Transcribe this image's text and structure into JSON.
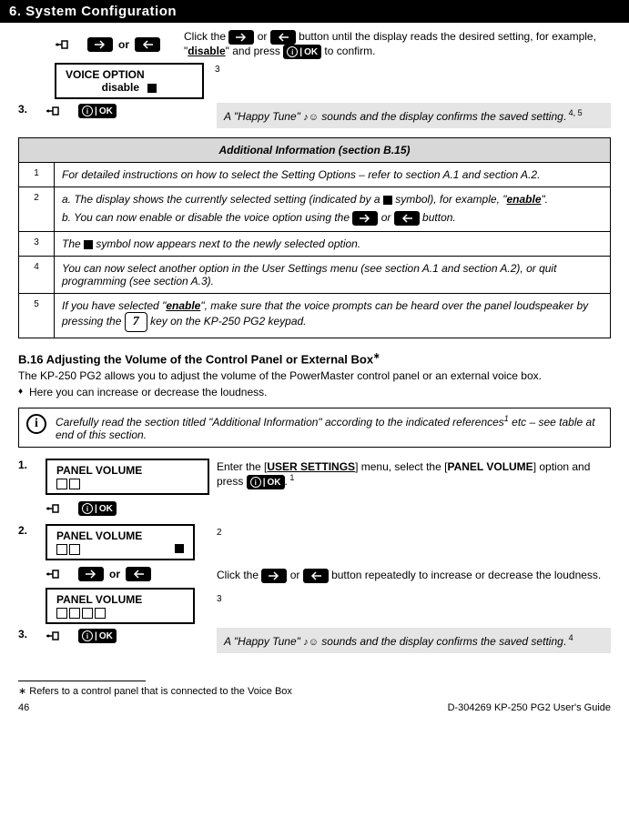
{
  "chapterTitle": "6. System Configuration",
  "voice": {
    "intro_pre": "Click the ",
    "intro_mid": " or ",
    "intro_post": " button until the display reads the desired setting, for example, \"",
    "bold_disable": "disable",
    "intro_after_bold": "\" and press ",
    "intro_end": " to confirm.",
    "lcd_line1": "VOICE OPTION",
    "lcd_line2_label": "disable",
    "ref3_marker": "3"
  },
  "step3": {
    "num": "3.",
    "msg_pre": "A \"Happy Tune\" ",
    "msg_post": " sounds and the display confirms the saved setting",
    "msg_period": ".",
    "msg_refs": " 4, 5"
  },
  "infoTable": {
    "heading": "Additional Information (section B.15)",
    "r1_num": "1",
    "r1": "For detailed instructions on how to select the Setting Options – refer to section A.1 and section A.2.",
    "r2_num": "2",
    "r2a_pre": "a.   The display shows the currently selected setting (indicated by a ",
    "r2a_post": " symbol), for example, \"",
    "r2a_bold": "enable",
    "r2a_end": "\".",
    "r2b_pre": "b.   You can now enable or disable the voice option using the ",
    "r2b_mid": " or ",
    "r2b_post": " button.",
    "r3_num": "3",
    "r3_pre": "The ",
    "r3_post": " symbol now appears next to the newly selected option.",
    "r4_num": "4",
    "r4": "You can now select another option in the User Settings menu (see section A.1 and section A.2), or quit programming (see section A.3).",
    "r5_num": "5",
    "r5_pre": "If you have selected \"",
    "r5_bold": "enable",
    "r5_mid": "\", make sure that the voice prompts can be heard over the panel loudspeaker by pressing the ",
    "r5_key": "7",
    "r5_post": " key on the KP-250 PG2 keypad."
  },
  "b16": {
    "heading": "B.16 Adjusting the Volume of the Control Panel or External Box",
    "heading_star": "∗",
    "p1": "The KP-250 PG2 allows you to adjust the volume of the PowerMaster control panel or an external voice box.",
    "p2": "Here you can increase or decrease the loudness.",
    "note": "Carefully read the section titled \"Additional Information\" according to the indicated references",
    "note_sup": "1",
    "note_post": " etc – see table at end of this section."
  },
  "vol": {
    "step1_num": "1.",
    "step1_lcd": "PANEL VOLUME",
    "step1_right_pre": "Enter the [",
    "step1_menu": "USER SETTINGS",
    "step1_right_mid": "] menu, select the [",
    "step1_option": "PANEL VOLUME",
    "step1_right_post": "] option and press ",
    "step1_right_end": ".",
    "step1_ref": " 1",
    "step2_num": "2.",
    "step2_lcd": "PANEL VOLUME",
    "step2_ref": "2",
    "step2_click_pre": "Click the ",
    "step2_click_mid": " or ",
    "step2_click_post": " button repeatedly to increase or decrease the loudness.",
    "step2_lcd2": "PANEL VOLUME",
    "step2_lcd2_ref": "3",
    "step3_num": "3.",
    "step3_msg_pre": "A \"Happy Tune\" ",
    "step3_msg_post": " sounds and the display confirms the saved setting",
    "step3_msg_period": ".",
    "step3_msg_ref": " 4"
  },
  "footnote": "∗ Refers to a control panel that is connected to the Voice Box",
  "footer_left": "46",
  "footer_right": "D-304269 KP-250 PG2 User's Guide",
  "labels": {
    "ok": "OK",
    "or": "or"
  }
}
